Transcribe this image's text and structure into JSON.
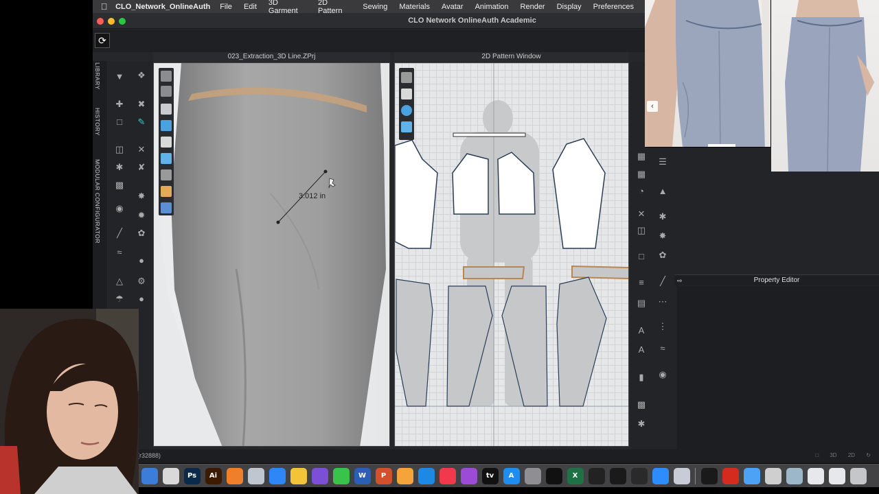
{
  "menubar": {
    "app_name": "CLO_Network_OnlineAuth",
    "items": [
      "File",
      "Edit",
      "3D Garment",
      "2D Pattern",
      "Sewing",
      "Materials",
      "Avatar",
      "Animation",
      "Render",
      "Display",
      "Preferences"
    ]
  },
  "window": {
    "title": "CLO Network OnlineAuth Academic"
  },
  "sidebar": {
    "tabs": [
      "LIBRARY",
      "HISTORY",
      "MODULAR CONFIGURATOR"
    ]
  },
  "panel3d": {
    "title": "023_Extraction_3D Line.ZPrj",
    "measurement_label": "3.012 in"
  },
  "panel2d": {
    "title": "2D Pattern Window"
  },
  "property_editor": {
    "title": "Property Editor"
  },
  "statusbar": {
    "text": "(r32888)",
    "right_labels": [
      "3D",
      "2D"
    ]
  },
  "dock": {
    "icons": [
      {
        "name": "finder-icon",
        "label": "",
        "color": "#3b7dd8"
      },
      {
        "name": "chrome-icon",
        "label": "",
        "color": "#d9d9d9"
      },
      {
        "name": "photoshop-icon",
        "label": "Ps",
        "color": "#0b2a4a"
      },
      {
        "name": "illustrator-icon",
        "label": "Ai",
        "color": "#3b1a00"
      },
      {
        "name": "launchpad-icon",
        "label": "",
        "color": "#ef7f2a"
      },
      {
        "name": "safari-alt-icon",
        "label": "",
        "color": "#bfc6d0"
      },
      {
        "name": "safari-icon",
        "label": "",
        "color": "#2f86f6"
      },
      {
        "name": "photos-icon",
        "label": "",
        "color": "#f3c33a"
      },
      {
        "name": "siri-icon",
        "label": "",
        "color": "#7b4fd6"
      },
      {
        "name": "messages-icon",
        "label": "",
        "color": "#39c34b"
      },
      {
        "name": "word-icon",
        "label": "W",
        "color": "#2b5eb5"
      },
      {
        "name": "powerpoint-icon",
        "label": "P",
        "color": "#d2502c"
      },
      {
        "name": "pages-icon",
        "label": "",
        "color": "#f4a43a"
      },
      {
        "name": "keynote-icon",
        "label": "",
        "color": "#1e88e5"
      },
      {
        "name": "music-icon",
        "label": "",
        "color": "#f1384d"
      },
      {
        "name": "podcasts-icon",
        "label": "",
        "color": "#9c4bd6"
      },
      {
        "name": "appletv-icon",
        "label": "tv",
        "color": "#111111"
      },
      {
        "name": "appstore-icon",
        "label": "A",
        "color": "#1f8cf0"
      },
      {
        "name": "settings-icon",
        "label": "",
        "color": "#8e8e93"
      },
      {
        "name": "clo-icon",
        "label": "",
        "color": "#111111"
      },
      {
        "name": "excel-icon",
        "label": "X",
        "color": "#1e7145"
      },
      {
        "name": "clock-icon",
        "label": "",
        "color": "#222222"
      },
      {
        "name": "vectorworks-icon",
        "label": "",
        "color": "#1a1a1a"
      },
      {
        "name": "quicktime-icon",
        "label": "",
        "color": "#2a2a2a"
      },
      {
        "name": "zoom-icon",
        "label": "",
        "color": "#2d8cff"
      },
      {
        "name": "preview-icon",
        "label": "",
        "color": "#c7ccd6"
      },
      {
        "name": "activity-monitor-icon",
        "label": "",
        "color": "#1a1a1a"
      },
      {
        "name": "acrobat-icon",
        "label": "",
        "color": "#d42b1e"
      },
      {
        "name": "mail-icon",
        "label": "",
        "color": "#4ea2f5"
      },
      {
        "name": "printer-icon",
        "label": "",
        "color": "#cfcfcf"
      },
      {
        "name": "user-folder-icon",
        "label": "",
        "color": "#9bb7c9"
      },
      {
        "name": "window-thumb-icon",
        "label": "",
        "color": "#e6e8ec"
      },
      {
        "name": "window-thumb-2-icon",
        "label": "",
        "color": "#e6e8ec"
      },
      {
        "name": "trash-icon",
        "label": "",
        "color": "#c4c6ca"
      }
    ]
  }
}
